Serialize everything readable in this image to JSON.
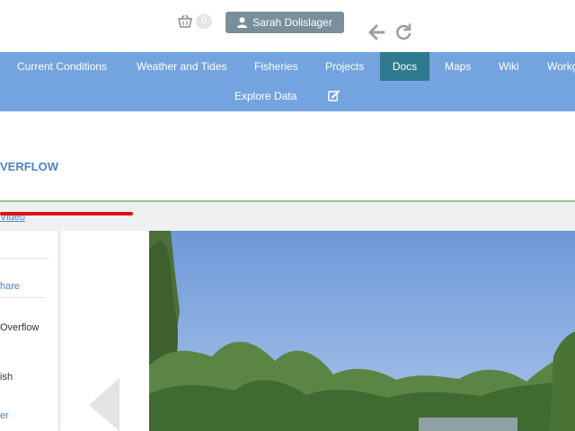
{
  "header": {
    "cart_count": "0",
    "user_name": "Sarah Dolislager"
  },
  "nav": {
    "items": [
      {
        "label": "Current Conditions"
      },
      {
        "label": "Weather and Tides"
      },
      {
        "label": "Fisheries"
      },
      {
        "label": "Projects"
      },
      {
        "label": "Docs"
      },
      {
        "label": "Maps"
      },
      {
        "label": "Wiki"
      },
      {
        "label": "Workg"
      }
    ],
    "active": "Docs",
    "explore": "Explore Data"
  },
  "page": {
    "title": "VERFLOW",
    "video_link": "Video"
  },
  "sidebar": {
    "items": [
      {
        "label": "hare"
      },
      {
        "label": "Overflow"
      },
      {
        "label": "ish"
      },
      {
        "label": "er"
      }
    ]
  },
  "colors": {
    "nav_bg": "#74a4e0",
    "nav_active": "#2f7a8e",
    "user_button": "#7a8f9c",
    "title_blue": "#4a84c8",
    "green_rule": "#9cc87a",
    "annotation_red": "#e30f0f"
  },
  "icons": [
    "basket-icon",
    "user-icon",
    "back-arrow-icon",
    "refresh-icon",
    "edit-icon",
    "previous-arrow-icon"
  ]
}
